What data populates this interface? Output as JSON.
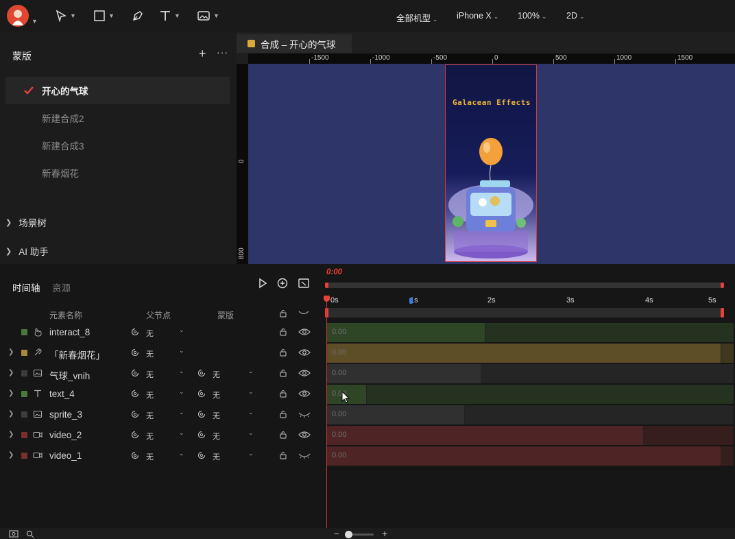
{
  "toolbar": {
    "tools": [
      "select-tool",
      "rectangle-tool",
      "pen-tool",
      "text-tool",
      "image-tool"
    ],
    "device_filter": "全部机型",
    "device": "iPhone X",
    "zoom": "100%",
    "view_mode": "2D"
  },
  "left_panel": {
    "title": "蒙版",
    "add": "+",
    "more": "···",
    "compositions": [
      {
        "label": "开心的气球",
        "active": true
      },
      {
        "label": "新建合成2",
        "active": false
      },
      {
        "label": "新建合成3",
        "active": false
      },
      {
        "label": "新春烟花",
        "active": false
      }
    ],
    "scene_tree": "场景树",
    "ai_assistant": "AI 助手"
  },
  "canvas": {
    "tab": "合成 – 开心的气球",
    "ruler_h": [
      "-1500",
      "-1000",
      "-500",
      "0",
      "500",
      "1000",
      "1500"
    ],
    "ruler_v": [
      "0",
      "800"
    ],
    "brand": "Galacean Effects",
    "accent": "#d9a93a"
  },
  "timeline": {
    "tab_timeline": "时间轴",
    "tab_assets": "资源",
    "timecode": "0:00",
    "seconds": [
      "0s",
      "1s",
      "2s",
      "3s",
      "4s",
      "5s"
    ],
    "headers": {
      "name": "元素名称",
      "parent": "父节点",
      "mask": "蒙版"
    },
    "rows": [
      {
        "name": "interact_8",
        "type": "interact-icon",
        "color": "#4a7a3a",
        "expand": false,
        "parent": "无",
        "mask": null,
        "visible": true,
        "clip_color": "#2f4626",
        "clip_end": 0.39,
        "clip_value": "0.00"
      },
      {
        "name": "「新春烟花」",
        "type": "link-icon",
        "color": "#a88a3a",
        "expand": true,
        "parent": "无",
        "mask": null,
        "visible": true,
        "clip_color": "#5e4e27",
        "clip_end": 0.97,
        "clip_value": "0.00"
      },
      {
        "name": "气球_vnih",
        "type": "image-icon",
        "color": "#3c3c3c",
        "expand": true,
        "parent": "无",
        "mask": "无",
        "visible": true,
        "clip_color": "#303030",
        "clip_end": 0.38,
        "clip_value": "0.00"
      },
      {
        "name": "text_4",
        "type": "text-icon",
        "color": "#4a7a3a",
        "expand": true,
        "parent": "无",
        "mask": "无",
        "visible": true,
        "clip_color": "#2f4626",
        "clip_end": 0.1,
        "clip_value": "0.00"
      },
      {
        "name": "sprite_3",
        "type": "image-icon",
        "color": "#3c3c3c",
        "expand": true,
        "parent": "无",
        "mask": "无",
        "visible": false,
        "clip_color": "#303030",
        "clip_end": 0.34,
        "clip_value": "0.00"
      },
      {
        "name": "video_2",
        "type": "video-icon",
        "color": "#7a2e2e",
        "expand": true,
        "parent": "无",
        "mask": "无",
        "visible": true,
        "clip_color": "#4f2424",
        "clip_end": 0.78,
        "clip_value": "0.00"
      },
      {
        "name": "video_1",
        "type": "video-icon",
        "color": "#7a2e2e",
        "expand": true,
        "parent": "无",
        "mask": "无",
        "visible": false,
        "clip_color": "#4f2424",
        "clip_end": 0.97,
        "clip_value": "0.00"
      }
    ]
  },
  "bottom": {
    "zoom_out": "−",
    "zoom_in": "+"
  }
}
